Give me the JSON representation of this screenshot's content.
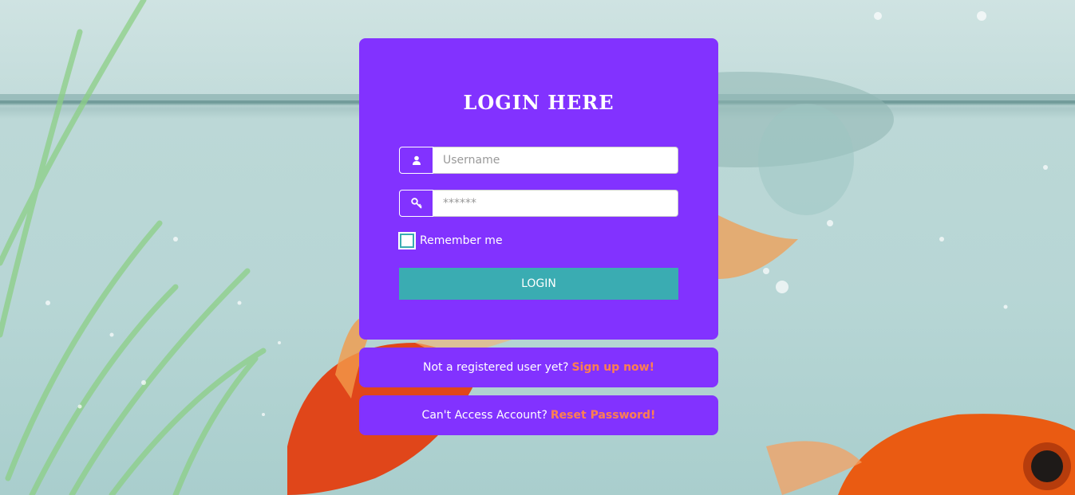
{
  "login": {
    "title": "LOGIN HERE",
    "username_placeholder": "Username",
    "password_placeholder": "******",
    "remember_label": "Remember me",
    "button_label": "LOGIN"
  },
  "signup": {
    "text": "Not a registered user yet?",
    "link": "Sign up now!"
  },
  "reset": {
    "text": "Can't Access Account?",
    "link": "Reset Password!"
  },
  "icons": {
    "username": "user-icon",
    "password": "key-icon"
  },
  "colors": {
    "card": "#8232ff",
    "button": "#3aacb2",
    "link": "#ff7f50"
  }
}
